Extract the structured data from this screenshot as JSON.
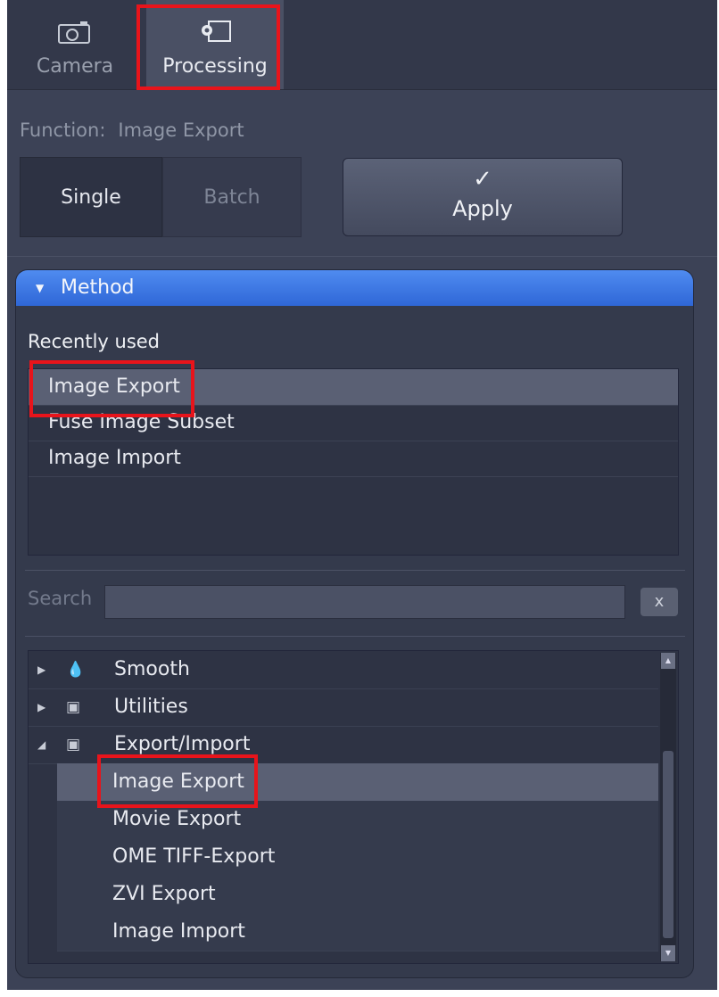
{
  "tabs": [
    {
      "label": "Camera",
      "icon": "camera-icon"
    },
    {
      "label": "Processing",
      "icon": "gear-image-icon"
    }
  ],
  "function": {
    "label": "Function:",
    "value": "Image Export"
  },
  "modes": {
    "single": "Single",
    "batch": "Batch"
  },
  "apply": {
    "label": "Apply",
    "icon": "checkmark-icon"
  },
  "method": {
    "header": "Method",
    "recent_label": "Recently used"
  },
  "recent_items": [
    "Image Export",
    "Fuse Image Subset",
    "Image Import"
  ],
  "search": {
    "label": "Search",
    "placeholder": "",
    "clear": "x"
  },
  "tree": {
    "groups": [
      {
        "label": "Smooth",
        "icon": "droplet-icon",
        "expanded": false
      },
      {
        "label": "Utilities",
        "icon": "toolbox-icon",
        "expanded": false
      },
      {
        "label": "Export/Import",
        "icon": "toolbox-icon",
        "expanded": true
      }
    ],
    "children": [
      "Image Export",
      "Movie Export",
      "OME TIFF-Export",
      "ZVI Export",
      "Image Import"
    ]
  },
  "colors": {
    "highlight": "#e8141b",
    "method_header": "#3a74e0",
    "panel": "#3c4256"
  }
}
